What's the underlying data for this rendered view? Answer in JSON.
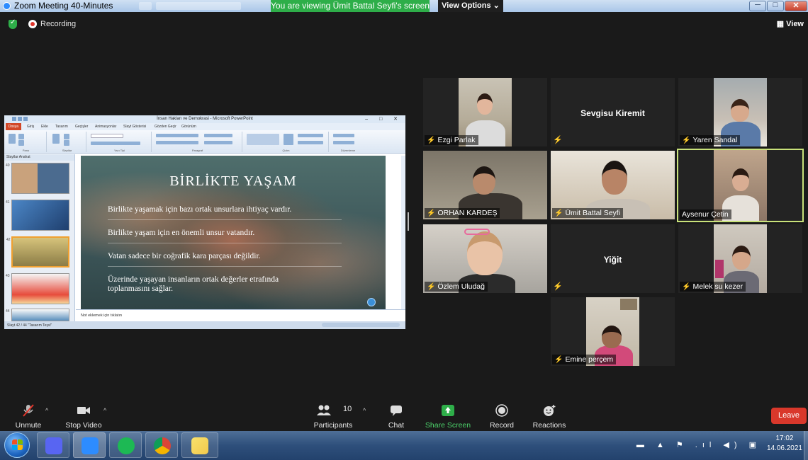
{
  "window": {
    "title": "Zoom Meeting 40-Minutes",
    "viewing_banner": "You are viewing Ümit Battal Seyfi's screen",
    "view_options": "View Options ⌄",
    "minimize": "─",
    "maximize": "□",
    "close": "✕"
  },
  "status": {
    "recording_label": "Recording",
    "view_button": "View"
  },
  "shared_screen": {
    "app_title": "İnsan Hakları ve Demokrasi - Microsoft PowerPoint",
    "window_controls": "– □ ✕",
    "file_tab": "Dosya",
    "ribbon_tabs": [
      "Giriş",
      "Ekle",
      "Tasarım",
      "Geçişler",
      "Animasyonlar",
      "Slayt Gösterisi",
      "Gözden Geçir",
      "Görünüm"
    ],
    "ribbon_groups": [
      "Pano",
      "Slaytlar",
      "Yazı Tipi",
      "Paragraf",
      "Çizim",
      "Düzenleme"
    ],
    "panel_tabs": "Slaytlar   Anahat",
    "thumb_numbers": [
      "40",
      "41",
      "42",
      "43",
      "44"
    ],
    "slide": {
      "title": "BİRLİKTE YAŞAM",
      "lines": [
        "Birlikte yaşamak için bazı ortak unsurlara ihtiyaç vardır.",
        "Birlikte yaşam için en önemli unsur vatandır.",
        "Vatan sadece bir coğrafik kara parçası değildir.",
        "Üzerinde yaşayan insanların ortak değerler etrafında",
        "toplanmasını sağlar."
      ]
    },
    "notes_placeholder": "Not eklemek için tıklatın",
    "status_text": "Slayt 42 / 44   \"Tasarım Teşvi\"",
    "zoom_text": "%%"
  },
  "participants": [
    {
      "name": "Ezgi Parlak",
      "muted": true,
      "video": true
    },
    {
      "name": "Sevgisu Kiremit",
      "muted": true,
      "video": false
    },
    {
      "name": "Yaren Sandal",
      "muted": true,
      "video": true
    },
    {
      "name": "ORHAN KARDEŞ",
      "muted": true,
      "video": true
    },
    {
      "name": "Ümit Battal Seyfi",
      "muted": true,
      "video": true
    },
    {
      "name": "Aysenur Çetin",
      "muted": false,
      "video": true,
      "active_speaker": true
    },
    {
      "name": "Özlem Uludağ",
      "muted": true,
      "video": true
    },
    {
      "name": "Yiğit",
      "muted": true,
      "video": false
    },
    {
      "name": "Melek su kezer",
      "muted": true,
      "video": true
    },
    {
      "name": "Emine  perçem",
      "muted": true,
      "video": true
    }
  ],
  "toolbar": {
    "unmute": "Unmute",
    "stop_video": "Stop Video",
    "participants": "Participants",
    "participant_count": "10",
    "chat": "Chat",
    "share_screen": "Share Screen",
    "record": "Record",
    "reactions": "Reactions",
    "leave": "Leave",
    "caret": "^"
  },
  "taskbar": {
    "apps": [
      "discord",
      "zoom",
      "spotify",
      "chrome",
      "sticky-notes"
    ],
    "tray": "▬ ▲ ⚑ .ıl ◀) ▣",
    "time": "17:02",
    "date": "14.06.2021"
  },
  "colors": {
    "zoom_bg": "#1a1a1a",
    "banner_green": "#2eae49",
    "leave_red": "#d9382b",
    "active_border": "#c9e27a",
    "muted_red": "#e0352b"
  }
}
